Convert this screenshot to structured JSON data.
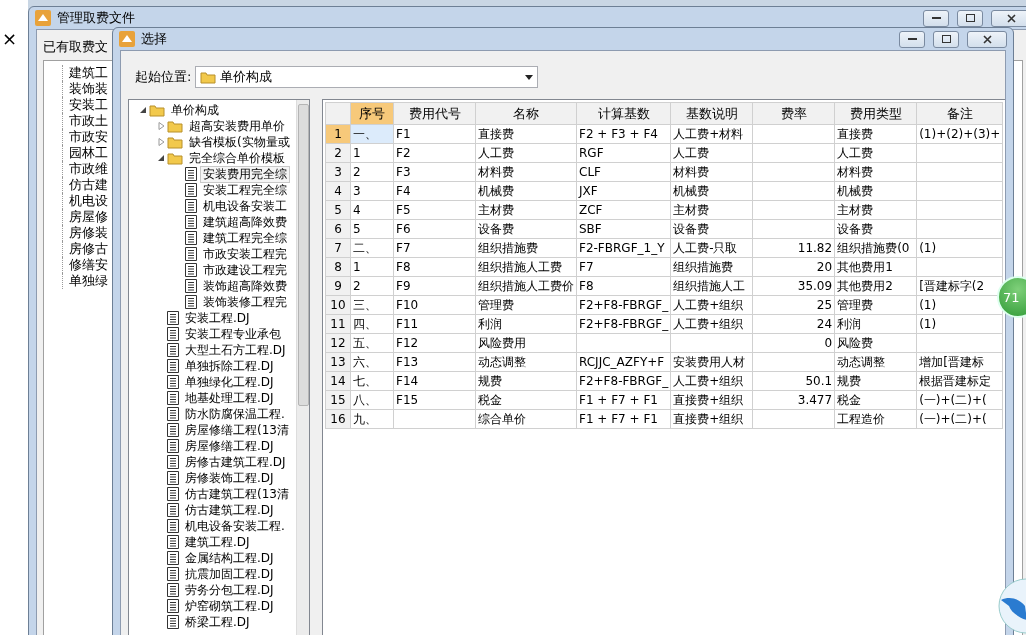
{
  "desktop": {
    "close_glyph": "×"
  },
  "outer_window": {
    "title": "管理取费文件",
    "group_title": "已有取费文",
    "items": [
      "建筑工",
      "装饰装",
      "安装工",
      "市政土",
      "市政安",
      "园林工",
      "市政维",
      "仿古建",
      "机电设",
      "房屋修",
      "房修装",
      "房修古",
      "修缮安",
      "单独绿"
    ]
  },
  "dialog": {
    "title": "选择",
    "location_label": "起始位置:",
    "location_value": "单价构成",
    "tree": [
      {
        "label": "单价构成",
        "kind": "folder",
        "expanded": true,
        "selected": false,
        "children": [
          {
            "label": "超高安装费用单价",
            "kind": "folder",
            "expanded": false,
            "selected": false
          },
          {
            "label": "缺省模板(实物量或",
            "kind": "folder",
            "expanded": false,
            "selected": false
          },
          {
            "label": "完全综合单价模板",
            "kind": "folder",
            "expanded": true,
            "selected": false,
            "children": [
              {
                "label": "安装费用完全综",
                "kind": "file",
                "selected": true
              },
              {
                "label": "安装工程完全综",
                "kind": "file",
                "selected": false
              },
              {
                "label": "机电设备安装工",
                "kind": "file",
                "selected": false
              },
              {
                "label": "建筑超高降效费",
                "kind": "file",
                "selected": false
              },
              {
                "label": "建筑工程完全综",
                "kind": "file",
                "selected": false
              },
              {
                "label": "市政安装工程完",
                "kind": "file",
                "selected": false
              },
              {
                "label": "市政建设工程完",
                "kind": "file",
                "selected": false
              },
              {
                "label": "装饰超高降效费",
                "kind": "file",
                "selected": false
              },
              {
                "label": "装饰装修工程完",
                "kind": "file",
                "selected": false
              }
            ]
          },
          {
            "label": "安装工程.DJ",
            "kind": "file",
            "selected": false
          },
          {
            "label": "安装工程专业承包",
            "kind": "file",
            "selected": false
          },
          {
            "label": "大型土石方工程.DJ",
            "kind": "file",
            "selected": false
          },
          {
            "label": "单独拆除工程.DJ",
            "kind": "file",
            "selected": false
          },
          {
            "label": "单独绿化工程.DJ",
            "kind": "file",
            "selected": false
          },
          {
            "label": "地基处理工程.DJ",
            "kind": "file",
            "selected": false
          },
          {
            "label": "防水防腐保温工程.",
            "kind": "file",
            "selected": false
          },
          {
            "label": "房屋修缮工程(13清",
            "kind": "file",
            "selected": false
          },
          {
            "label": "房屋修缮工程.DJ",
            "kind": "file",
            "selected": false
          },
          {
            "label": "房修古建筑工程.DJ",
            "kind": "file",
            "selected": false
          },
          {
            "label": "房修装饰工程.DJ",
            "kind": "file",
            "selected": false
          },
          {
            "label": "仿古建筑工程(13清",
            "kind": "file",
            "selected": false
          },
          {
            "label": "仿古建筑工程.DJ",
            "kind": "file",
            "selected": false
          },
          {
            "label": "机电设备安装工程.",
            "kind": "file",
            "selected": false
          },
          {
            "label": "建筑工程.DJ",
            "kind": "file",
            "selected": false
          },
          {
            "label": "金属结构工程.DJ",
            "kind": "file",
            "selected": false
          },
          {
            "label": "抗震加固工程.DJ",
            "kind": "file",
            "selected": false
          },
          {
            "label": "劳务分包工程.DJ",
            "kind": "file",
            "selected": false
          },
          {
            "label": "炉窑砌筑工程.DJ",
            "kind": "file",
            "selected": false
          },
          {
            "label": "桥梁工程.DJ",
            "kind": "file",
            "selected": false
          }
        ]
      }
    ],
    "table": {
      "columns": [
        {
          "label": "序号",
          "selected": true
        },
        {
          "label": "费用代号",
          "selected": false
        },
        {
          "label": "名称",
          "selected": false
        },
        {
          "label": "计算基数",
          "selected": false
        },
        {
          "label": "基数说明",
          "selected": false
        },
        {
          "label": "费率",
          "selected": false
        },
        {
          "label": "费用类型",
          "selected": false
        },
        {
          "label": "备注",
          "selected": false
        }
      ],
      "rows": [
        {
          "number": "1",
          "selected": true,
          "cells": [
            "一、",
            "F1",
            "直接费",
            "F2 + F3 + F4",
            "人工费+材料",
            "",
            "直接费",
            "(1)+(2)+(3)+"
          ]
        },
        {
          "number": "2",
          "selected": false,
          "cells": [
            "1",
            "F2",
            "人工费",
            "RGF",
            "人工费",
            "",
            "人工费",
            ""
          ]
        },
        {
          "number": "3",
          "selected": false,
          "cells": [
            "2",
            "F3",
            "材料费",
            "CLF",
            "材料费",
            "",
            "材料费",
            ""
          ]
        },
        {
          "number": "4",
          "selected": false,
          "cells": [
            "3",
            "F4",
            "机械费",
            "JXF",
            "机械费",
            "",
            "机械费",
            ""
          ]
        },
        {
          "number": "5",
          "selected": false,
          "cells": [
            "4",
            "F5",
            "主材费",
            "ZCF",
            "主材费",
            "",
            "主材费",
            ""
          ]
        },
        {
          "number": "6",
          "selected": false,
          "cells": [
            "5",
            "F6",
            "设备费",
            "SBF",
            "设备费",
            "",
            "设备费",
            ""
          ]
        },
        {
          "number": "7",
          "selected": false,
          "cells": [
            "二、",
            "F7",
            "组织措施费",
            "F2-FBRGF_1_Y",
            "人工费-只取",
            "11.82",
            "组织措施费(0",
            "(1)"
          ]
        },
        {
          "number": "8",
          "selected": false,
          "cells": [
            "1",
            "F8",
            "组织措施人工费",
            "F7",
            "组织措施费",
            "20",
            "其他费用1",
            ""
          ]
        },
        {
          "number": "9",
          "selected": false,
          "cells": [
            "2",
            "F9",
            "组织措施人工费价",
            "F8",
            "组织措施人工",
            "35.09",
            "其他费用2",
            "[晋建标字(2"
          ]
        },
        {
          "number": "10",
          "selected": false,
          "cells": [
            "三、",
            "F10",
            "管理费",
            "F2+F8-FBRGF_",
            "人工费+组织",
            "25",
            "管理费",
            "(1)"
          ]
        },
        {
          "number": "11",
          "selected": false,
          "cells": [
            "四、",
            "F11",
            "利润",
            "F2+F8-FBRGF_",
            "人工费+组织",
            "24",
            "利润",
            "(1)"
          ]
        },
        {
          "number": "12",
          "selected": false,
          "cells": [
            "五、",
            "F12",
            "风险费用",
            "",
            "",
            "0",
            "风险费",
            ""
          ]
        },
        {
          "number": "13",
          "selected": false,
          "cells": [
            "六、",
            "F13",
            "动态调整",
            "RCJJC_AZFY+F",
            "安装费用人材",
            "",
            "动态调整",
            "增加[晋建标"
          ]
        },
        {
          "number": "14",
          "selected": false,
          "cells": [
            "七、",
            "F14",
            "规费",
            "F2+F8-FBRGF_",
            "人工费+组织",
            "50.1",
            "规费",
            "根据晋建标定"
          ]
        },
        {
          "number": "15",
          "selected": false,
          "cells": [
            "八、",
            "F15",
            "税金",
            "F1 + F7 + F1",
            "直接费+组织",
            "3.477",
            "税金",
            "(一)+(二)+("
          ]
        },
        {
          "number": "16",
          "selected": false,
          "cells": [
            "九、",
            "",
            "综合单价",
            "F1 + F7 + F1",
            "直接费+组织",
            "",
            "工程造价",
            "(一)+(二)+("
          ]
        }
      ]
    }
  },
  "speed_ball": {
    "text": "71"
  }
}
